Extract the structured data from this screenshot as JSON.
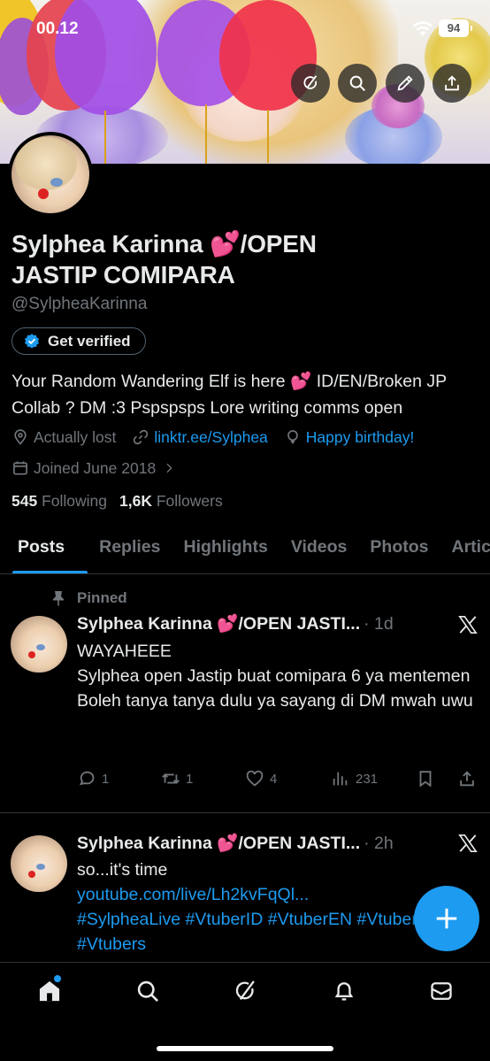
{
  "status_bar": {
    "time": "00.12",
    "battery": "94"
  },
  "colors": {
    "accent": "#1d9bf0",
    "background": "#000000",
    "muted": "#71767b",
    "text": "#e7e9ea",
    "divider": "#2f3336"
  },
  "banner_actions": [
    {
      "icon": "grok-icon"
    },
    {
      "icon": "search-icon"
    },
    {
      "icon": "edit-pencil-icon"
    },
    {
      "icon": "share-icon"
    }
  ],
  "profile": {
    "display_name": "Sylphea Karinna 💕/OPEN JASTIP COMIPARA",
    "handle": "@SylpheaKarinna",
    "verify_label": "Get verified",
    "bio": "Your Random Wandering Elf is here 💕 ID/EN/Broken JP Collab ? DM :3 Pspspsps Lore writing comms open",
    "location": "Actually lost",
    "link": "linktr.ee/Sylphea",
    "birthday": "Happy birthday!",
    "joined": "Joined June 2018",
    "following_count": "545",
    "following_label": "Following",
    "followers_count": "1,6K",
    "followers_label": "Followers"
  },
  "tabs": [
    {
      "label": "Posts",
      "active": true
    },
    {
      "label": "Replies",
      "active": false
    },
    {
      "label": "Highlights",
      "active": false
    },
    {
      "label": "Videos",
      "active": false
    },
    {
      "label": "Photos",
      "active": false
    },
    {
      "label": "Articles",
      "active": false
    }
  ],
  "posts": [
    {
      "pinned_label": "Pinned",
      "author": "Sylphea Karinna 💕/OPEN JASTI...",
      "time": "· 1d",
      "lines": [
        "WAYAHEEE",
        "Sylphea open Jastip buat comipara 6 ya mentemen",
        "Boleh tanya tanya dulu ya sayang di DM mwah uwu"
      ],
      "replies": "1",
      "reposts": "1",
      "likes": "4",
      "views": "231"
    },
    {
      "author": "Sylphea Karinna 💕/OPEN JASTI...",
      "time": "· 2h",
      "text": "so...it's time",
      "link": "youtube.com/live/Lh2kvFqQl...",
      "hashtags": "#SylpheaLive #VtuberID #VtuberEN #Vtuber",
      "hashtags2": "#Vtubers"
    }
  ],
  "bottom_nav": [
    {
      "icon": "home-icon",
      "active": true
    },
    {
      "icon": "search-icon",
      "active": false
    },
    {
      "icon": "grok-icon",
      "active": false
    },
    {
      "icon": "bell-icon",
      "active": false
    },
    {
      "icon": "mail-icon",
      "active": false
    }
  ],
  "fab_icon": "plus-icon"
}
